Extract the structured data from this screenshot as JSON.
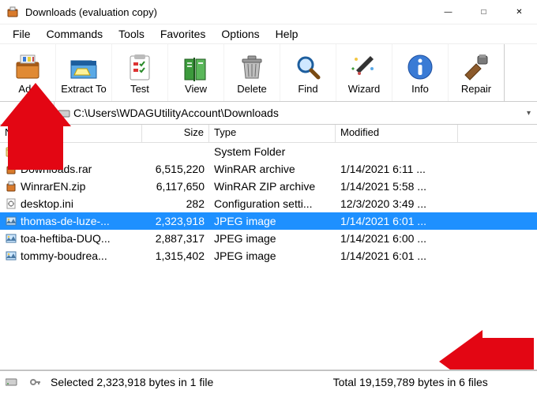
{
  "window": {
    "title": "Downloads (evaluation copy)"
  },
  "menu": {
    "items": [
      "File",
      "Commands",
      "Tools",
      "Favorites",
      "Options",
      "Help"
    ]
  },
  "toolbar": {
    "items": [
      {
        "label": "Add",
        "icon": "add"
      },
      {
        "label": "Extract To",
        "icon": "extract"
      },
      {
        "label": "Test",
        "icon": "test"
      },
      {
        "label": "View",
        "icon": "view"
      },
      {
        "label": "Delete",
        "icon": "delete"
      },
      {
        "label": "Find",
        "icon": "find"
      },
      {
        "label": "Wizard",
        "icon": "wizard"
      },
      {
        "label": "Info",
        "icon": "info"
      },
      {
        "label": "Repair",
        "icon": "repair"
      }
    ]
  },
  "address": {
    "path": "C:\\Users\\WDAGUtilityAccount\\Downloads"
  },
  "columns": {
    "name": "Name",
    "size": "Size",
    "type": "Type",
    "modified": "Modified"
  },
  "rows": [
    {
      "icon": "up",
      "name": "..",
      "size": "",
      "type": "System Folder",
      "modified": "",
      "selected": false
    },
    {
      "icon": "rar",
      "name": "Downloads.rar",
      "size": "6,515,220",
      "type": "WinRAR archive",
      "modified": "1/14/2021 6:11 ...",
      "selected": false
    },
    {
      "icon": "rar",
      "name": "WinrarEN.zip",
      "size": "6,117,650",
      "type": "WinRAR ZIP archive",
      "modified": "1/14/2021 5:58 ...",
      "selected": false
    },
    {
      "icon": "ini",
      "name": "desktop.ini",
      "size": "282",
      "type": "Configuration setti...",
      "modified": "12/3/2020 3:49 ...",
      "selected": false
    },
    {
      "icon": "jpg",
      "name": "thomas-de-luze-...",
      "size": "2,323,918",
      "type": "JPEG image",
      "modified": "1/14/2021 6:01 ...",
      "selected": true
    },
    {
      "icon": "jpg",
      "name": "toa-heftiba-DUQ...",
      "size": "2,887,317",
      "type": "JPEG image",
      "modified": "1/14/2021 6:00 ...",
      "selected": false
    },
    {
      "icon": "jpg",
      "name": "tommy-boudrea...",
      "size": "1,315,402",
      "type": "JPEG image",
      "modified": "1/14/2021 6:01 ...",
      "selected": false
    }
  ],
  "status": {
    "selected": "Selected 2,323,918 bytes in 1 file",
    "total": "Total 19,159,789 bytes in 6 files"
  }
}
